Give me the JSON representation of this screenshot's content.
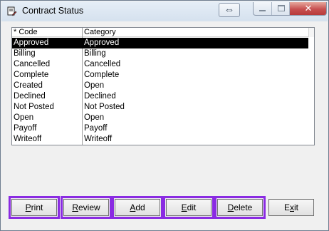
{
  "window": {
    "title": "Contract Status",
    "resize_glyph": "⇔",
    "close_glyph": "✕"
  },
  "list": {
    "columns": [
      "* Code",
      "Category"
    ],
    "selected_index": 0,
    "rows": [
      {
        "code": "Approved",
        "category": "Approved"
      },
      {
        "code": "Billing",
        "category": "Billing"
      },
      {
        "code": "Cancelled",
        "category": "Cancelled"
      },
      {
        "code": "Complete",
        "category": "Complete"
      },
      {
        "code": "Created",
        "category": "Open"
      },
      {
        "code": "Declined",
        "category": "Declined"
      },
      {
        "code": "Not Posted",
        "category": "Not Posted"
      },
      {
        "code": "Open",
        "category": "Open"
      },
      {
        "code": "Payoff",
        "category": "Payoff"
      },
      {
        "code": "Writeoff",
        "category": "Writeoff"
      }
    ]
  },
  "buttons": {
    "print": {
      "accel": "P",
      "rest": "rint"
    },
    "review": {
      "accel": "R",
      "rest": "eview"
    },
    "add": {
      "accel": "A",
      "rest": "dd"
    },
    "edit": {
      "accel": "E",
      "rest": "dit"
    },
    "delete": {
      "accel": "D",
      "rest": "elete"
    },
    "exit": {
      "prefix": "E",
      "accel": "x",
      "rest": "it"
    }
  },
  "colors": {
    "highlight_outline": "#8a2be2",
    "selection_bg": "#000000",
    "selection_fg": "#ffffff"
  }
}
